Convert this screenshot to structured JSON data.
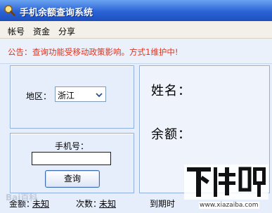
{
  "window": {
    "title": "手机余额查询系统"
  },
  "menu": [
    "帐号",
    "资金",
    "分享"
  ],
  "notice": {
    "label": "公告：",
    "text": "查询功能受移动政策影响。方式1维护中!"
  },
  "region": {
    "label": "地区：",
    "selected": "浙江"
  },
  "phone": {
    "label": "手机号：",
    "value": "",
    "button": "查询"
  },
  "result": {
    "name_label": "姓名：",
    "balance_label": "余额："
  },
  "statusbar": {
    "funds_label": "金额：",
    "funds_value": "未知",
    "count_label": "次数：",
    "count_value": "未知",
    "expiry_label": "到期时"
  },
  "watermarks": {
    "baidu": "Bai百科",
    "logo": "下载吧",
    "url": "www.xiazaiba.com"
  },
  "colors": {
    "titlebar": "#2a63d6",
    "notice_text": "#e0331f",
    "panel_bg": "#e6eefb"
  }
}
